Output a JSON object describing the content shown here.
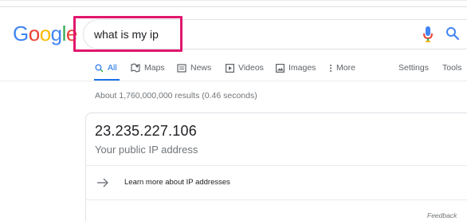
{
  "logo": {
    "letters": [
      "G",
      "o",
      "o",
      "g",
      "l",
      "e"
    ],
    "colors": [
      "#4285F4",
      "#EA4335",
      "#FBBC05",
      "#4285F4",
      "#34A853",
      "#EA4335"
    ]
  },
  "search": {
    "value": "what is my ip",
    "highlight_color": "#e0176d",
    "icons": [
      "mic-icon",
      "search-icon"
    ]
  },
  "tabs": {
    "items": [
      {
        "label": "All",
        "icon": "search-icon",
        "active": true
      },
      {
        "label": "Maps",
        "icon": "map-icon"
      },
      {
        "label": "News",
        "icon": "news-icon"
      },
      {
        "label": "Videos",
        "icon": "play-icon"
      },
      {
        "label": "Images",
        "icon": "image-icon"
      },
      {
        "label": "More",
        "icon": "more-vert-icon"
      }
    ],
    "settings": "Settings",
    "tools": "Tools",
    "accent": "#1a73e8"
  },
  "results": {
    "stats": "About 1,760,000,000 results (0.46 seconds)"
  },
  "ip_card": {
    "ip": "23.235.227.106",
    "subtitle": "Your public IP address",
    "learn_more": "Learn more about IP addresses",
    "feedback": "Feedback"
  }
}
